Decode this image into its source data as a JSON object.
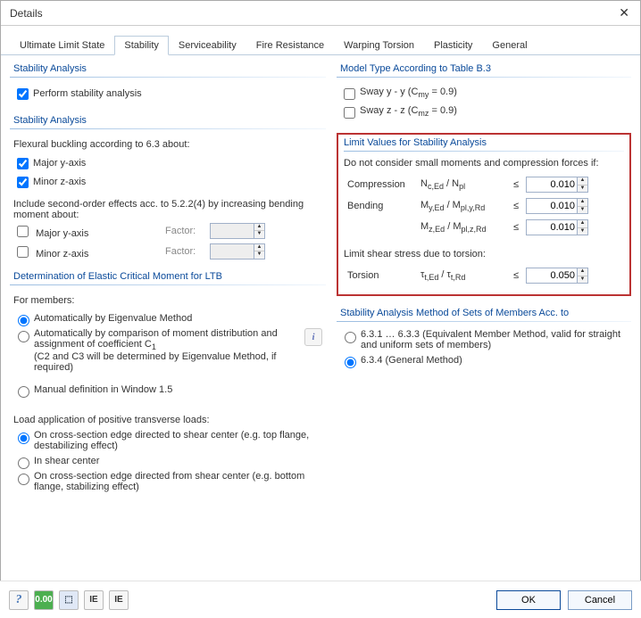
{
  "window": {
    "title": "Details"
  },
  "tabs": {
    "ultimate": "Ultimate Limit State",
    "stability": "Stability",
    "serviceability": "Serviceability",
    "fire": "Fire Resistance",
    "warping": "Warping Torsion",
    "plasticity": "Plasticity",
    "general": "General"
  },
  "groups": {
    "stab_analysis1": "Stability Analysis",
    "stab_analysis2": "Stability Analysis",
    "elastic_moment": "Determination of Elastic Critical Moment for LTB",
    "model_type": "Model Type According to Table B.3",
    "limit_values": "Limit Values for Stability Analysis",
    "method_sets": "Stability Analysis Method of Sets of Members Acc. to"
  },
  "chk": {
    "perform": "Perform stability analysis",
    "major_y": "Major y-axis",
    "minor_z": "Minor z-axis",
    "so_major_y": "Major y-axis",
    "so_minor_z": "Minor z-axis",
    "sway_y": "Sway y - y (Cmy = 0.9)",
    "sway_z": "Sway z - z (Cmz = 0.9)"
  },
  "labels": {
    "flexural_intro": "Flexural buckling according to 6.3 about:",
    "second_order_intro": "Include second-order effects acc. to 5.2.2(4) by increasing bending moment about:",
    "factor": "Factor:",
    "for_members": "For members:",
    "auto_eigen": "Automatically by Eigenvalue Method",
    "auto_compare": "Automatically by comparison of moment distribution and assignment of coefficient C",
    "auto_compare_sub": "(C2 and C3 will be determined by Eigenvalue Method, if required)",
    "manual_def": "Manual definition in Window 1.5",
    "load_app_intro": "Load application of positive transverse loads:",
    "on_edge_to": "On cross-section edge directed to shear center (e.g. top flange, destabilizing effect)",
    "in_shear": "In shear center",
    "on_edge_from": "On cross-section edge directed from shear center (e.g. bottom flange, stabilizing effect)",
    "limit_intro": "Do not consider small moments and compression forces if:",
    "compression": "Compression",
    "bending": "Bending",
    "torsion_intro": "Limit shear stress due to torsion:",
    "torsion": "Torsion",
    "method_633": "6.3.1 … 6.3.3 (Equivalent Member Method, valid for straight and uniform sets of members)",
    "method_634": "6.3.4  (General Method)",
    "le": "≤"
  },
  "formulas": {
    "compression": "N<sub>c,Ed</sub> / N<sub>pl</sub>",
    "bending_y": "M<sub>y,Ed</sub> / M<sub>pl,y,Rd</sub>",
    "bending_z": "M<sub>z,Ed</sub> / M<sub>pl,z,Rd</sub>",
    "torsion": "τ<sub>t,Ed</sub> / τ<sub>t,Rd</sub>"
  },
  "values": {
    "factor_y": "",
    "factor_z": "",
    "compression": "0.010",
    "bending_y": "0.010",
    "bending_z": "0.010",
    "torsion": "0.050"
  },
  "icons": {
    "f1": "?",
    "f2": "0.00",
    "f3": "⬚",
    "f4": "IE",
    "f5": "IE"
  },
  "buttons": {
    "ok": "OK",
    "cancel": "Cancel"
  }
}
